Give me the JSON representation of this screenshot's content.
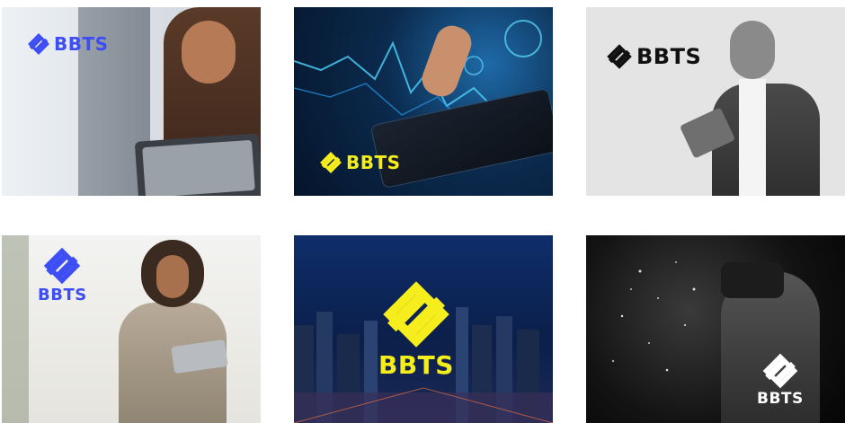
{
  "brand": {
    "name": "BBTS",
    "colors": {
      "blue": "#3d4ef5",
      "yellow": "#f6ee1c",
      "black": "#111111",
      "white": "#ffffff"
    }
  },
  "tiles": [
    {
      "scene": "woman-with-tablet-office",
      "logo_text": "BBTS",
      "logo_color": "#3d4ef5"
    },
    {
      "scene": "hand-touching-financial-tablet",
      "logo_text": "BBTS",
      "logo_color": "#f6ee1c"
    },
    {
      "scene": "man-with-tablet-grayscale",
      "logo_text": "BBTS",
      "logo_color": "#111111"
    },
    {
      "scene": "woman-with-tablet-bright-office",
      "logo_text": "BBTS",
      "logo_color": "#3d4ef5"
    },
    {
      "scene": "city-skyline-night",
      "logo_text": "BBTS",
      "logo_color": "#f6ee1c"
    },
    {
      "scene": "woman-vr-headset-grayscale",
      "logo_text": "BBTS",
      "logo_color": "#ffffff"
    }
  ]
}
